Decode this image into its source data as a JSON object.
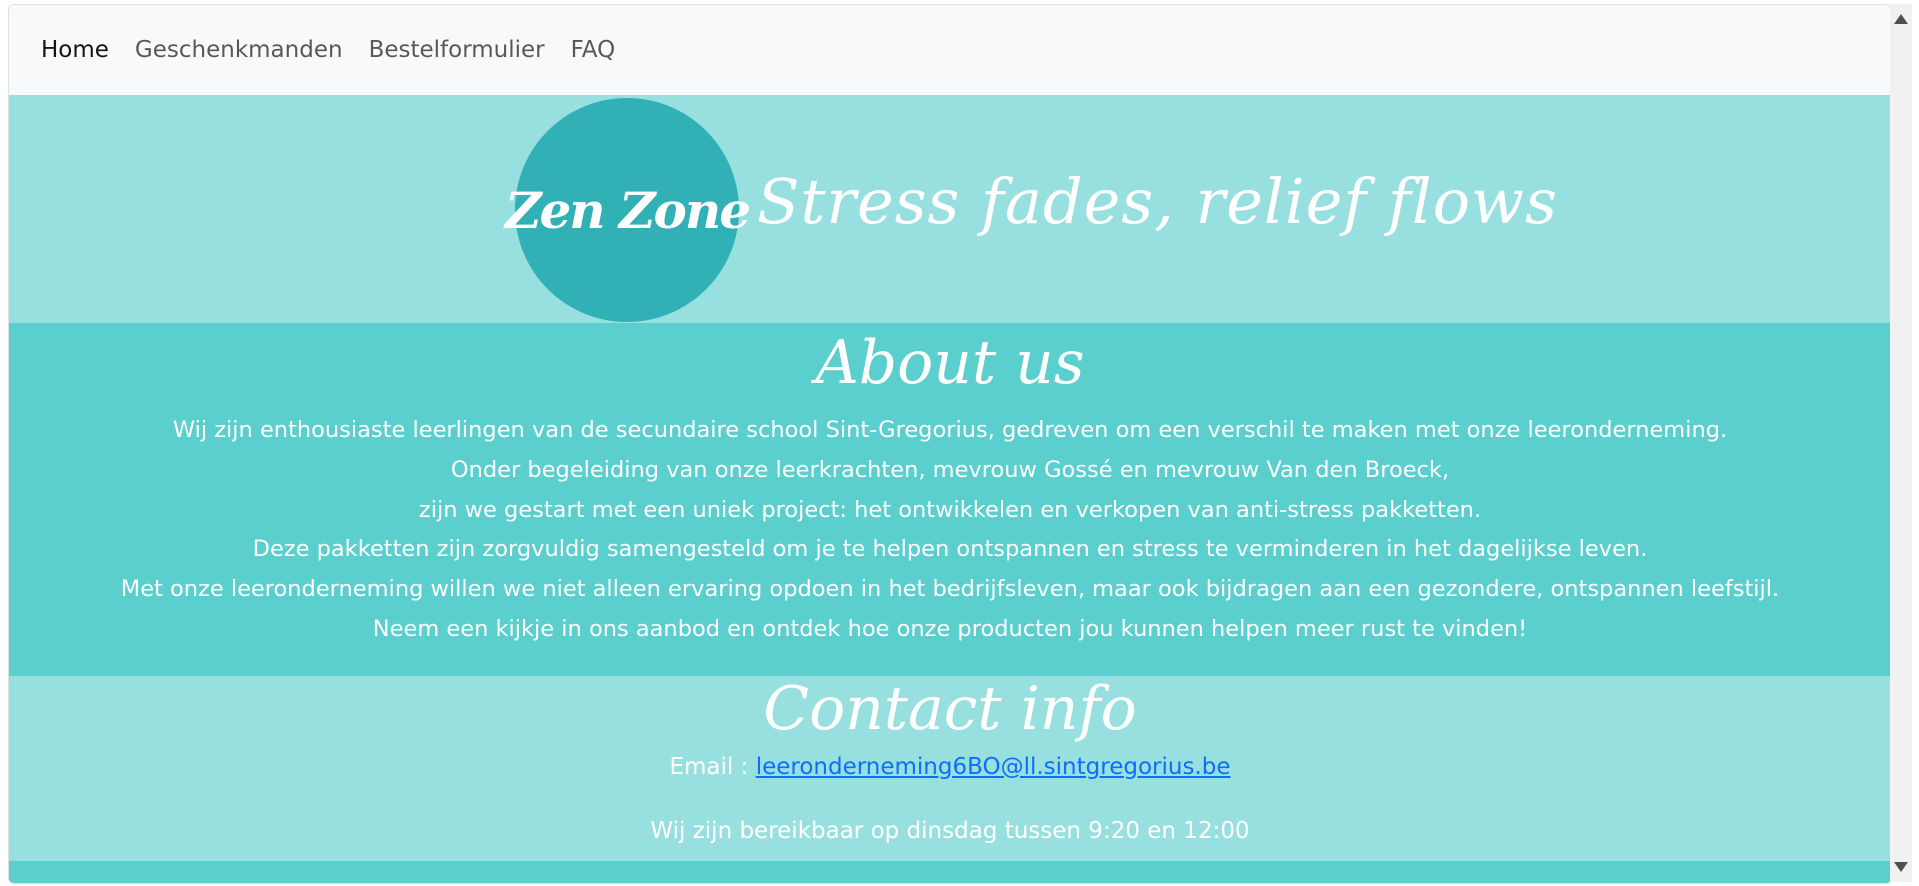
{
  "nav": {
    "items": [
      {
        "label": "Home",
        "active": true
      },
      {
        "label": "Geschenkmanden",
        "active": false
      },
      {
        "label": "Bestelformulier",
        "active": false
      },
      {
        "label": "FAQ",
        "active": false
      }
    ]
  },
  "hero": {
    "logo_text": "Zen Zone",
    "slogan": "Stress fades, relief flows"
  },
  "about": {
    "title": "About us",
    "lines": [
      "Wij zijn enthousiaste leerlingen van de secundaire school Sint-Gregorius, gedreven om een verschil te maken met onze leeronderneming.",
      "Onder begeleiding van onze leerkrachten, mevrouw Gossé en mevrouw Van den Broeck,",
      "zijn we gestart met een uniek project: het ontwikkelen en verkopen van anti-stress pakketten.",
      "Deze pakketten zijn zorgvuldig samengesteld om je te helpen ontspannen en stress te verminderen in het dagelijkse leven.",
      "Met onze leeronderneming willen we niet alleen ervaring opdoen in het bedrijfsleven, maar ook bijdragen aan een gezondere, ontspannen leefstijl.",
      "Neem een kijkje in ons aanbod en ontdek hoe onze producten jou kunnen helpen meer rust te vinden!"
    ]
  },
  "contact": {
    "title": "Contact info",
    "email_label": "Email : ",
    "email": "leeronderneming6BO@ll.sintgregorius.be",
    "hours": "Wij zijn bereikbaar op dinsdag tussen 9:20 en 12:00"
  },
  "colors": {
    "light_teal": "#98e0df",
    "mid_teal": "#5bcece",
    "logo_teal": "#31b0b6",
    "link_blue": "#0d6efd"
  }
}
